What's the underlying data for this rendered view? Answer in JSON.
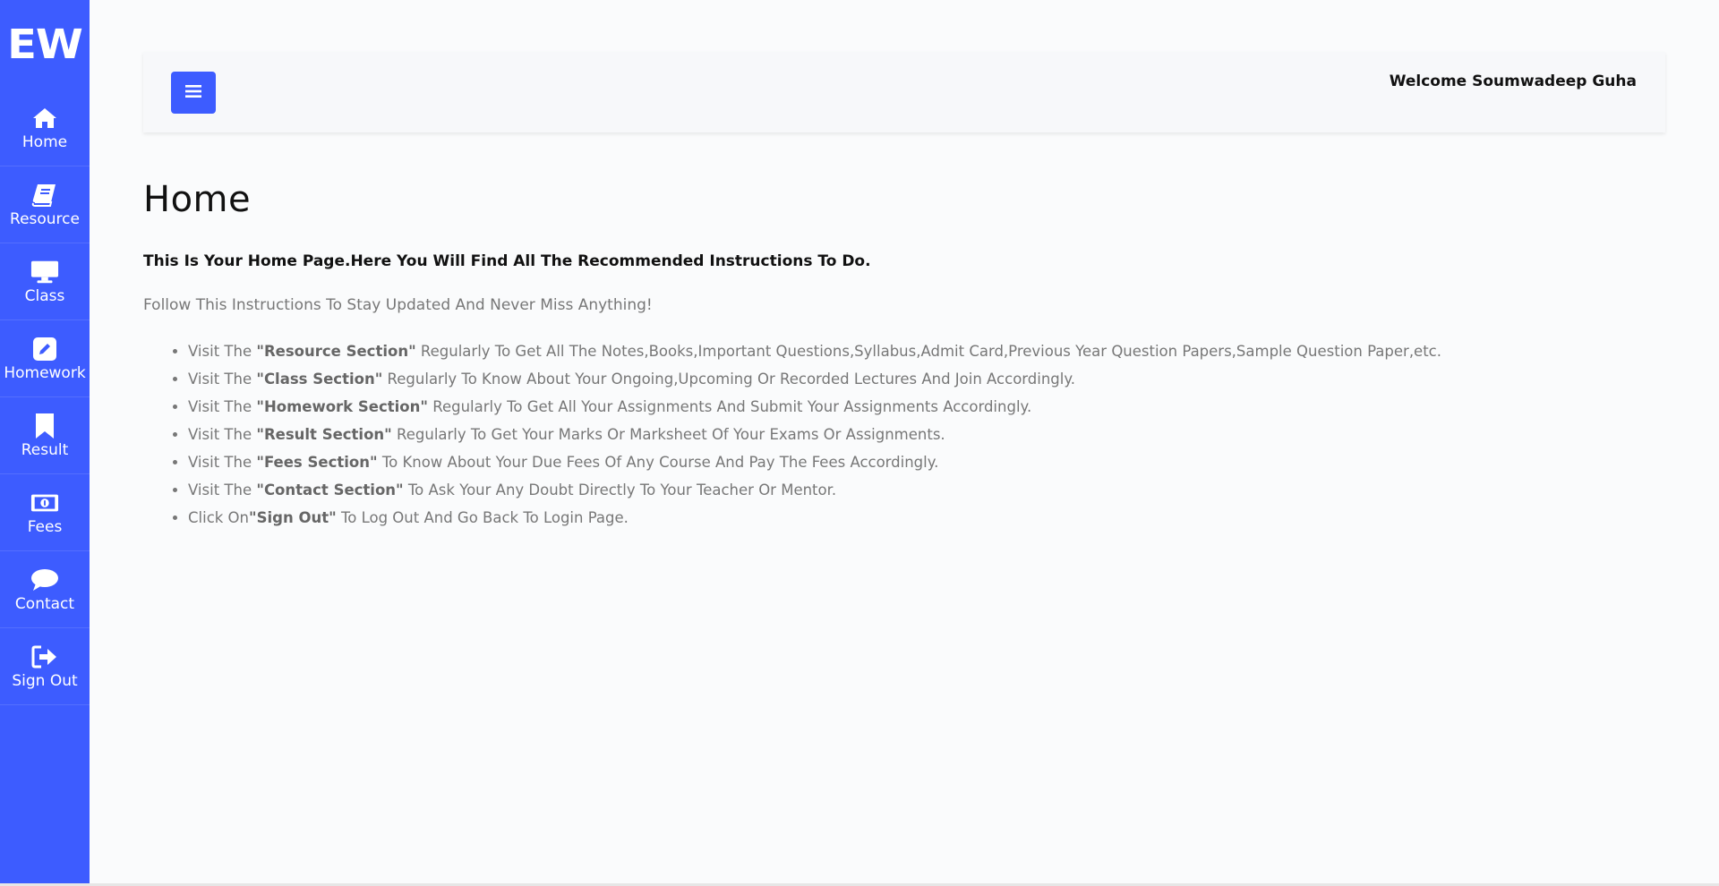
{
  "logo": "EW",
  "sidebar": {
    "items": [
      {
        "label": "Home",
        "icon": "home-icon"
      },
      {
        "label": "Resource",
        "icon": "book-icon"
      },
      {
        "label": "Class",
        "icon": "desktop-icon"
      },
      {
        "label": "Homework",
        "icon": "edit-icon"
      },
      {
        "label": "Result",
        "icon": "bookmark-icon"
      },
      {
        "label": "Fees",
        "icon": "money-icon"
      },
      {
        "label": "Contact",
        "icon": "comment-icon"
      },
      {
        "label": "Sign Out",
        "icon": "sign-out-icon"
      }
    ]
  },
  "header": {
    "menu_icon": "hamburger-icon",
    "welcome": "Welcome Soumwadeep Guha"
  },
  "main": {
    "title": "Home",
    "intro": "This Is Your Home Page.Here You Will Find All The Recommended Instructions To Do.",
    "subtitle": "Follow This Instructions To Stay Updated And Never Miss Anything!",
    "instructions": [
      {
        "pre": "Visit The ",
        "bold": "\"Resource Section\"",
        "post": " Regularly To Get All The Notes,Books,Important Questions,Syllabus,Admit Card,Previous Year Question Papers,Sample Question Paper,etc."
      },
      {
        "pre": "Visit The ",
        "bold": "\"Class Section\"",
        "post": " Regularly To Know About Your Ongoing,Upcoming Or Recorded Lectures And Join Accordingly."
      },
      {
        "pre": "Visit The ",
        "bold": "\"Homework Section\"",
        "post": " Regularly To Get All Your Assignments And Submit Your Assignments Accordingly."
      },
      {
        "pre": "Visit The ",
        "bold": "\"Result Section\"",
        "post": " Regularly To Get Your Marks Or Marksheet Of Your Exams Or Assignments."
      },
      {
        "pre": "Visit The ",
        "bold": "\"Fees Section\"",
        "post": " To Know About Your Due Fees Of Any Course And Pay The Fees Accordingly."
      },
      {
        "pre": "Visit The ",
        "bold": "\"Contact Section\"",
        "post": " To Ask Your Any Doubt Directly To Your Teacher Or Mentor."
      },
      {
        "pre": "Click On",
        "bold": "\"Sign Out\"",
        "post": " To Log Out And Go Back To Login Page."
      }
    ]
  },
  "colors": {
    "accent": "#3d5cff",
    "background": "#fafbfc"
  }
}
